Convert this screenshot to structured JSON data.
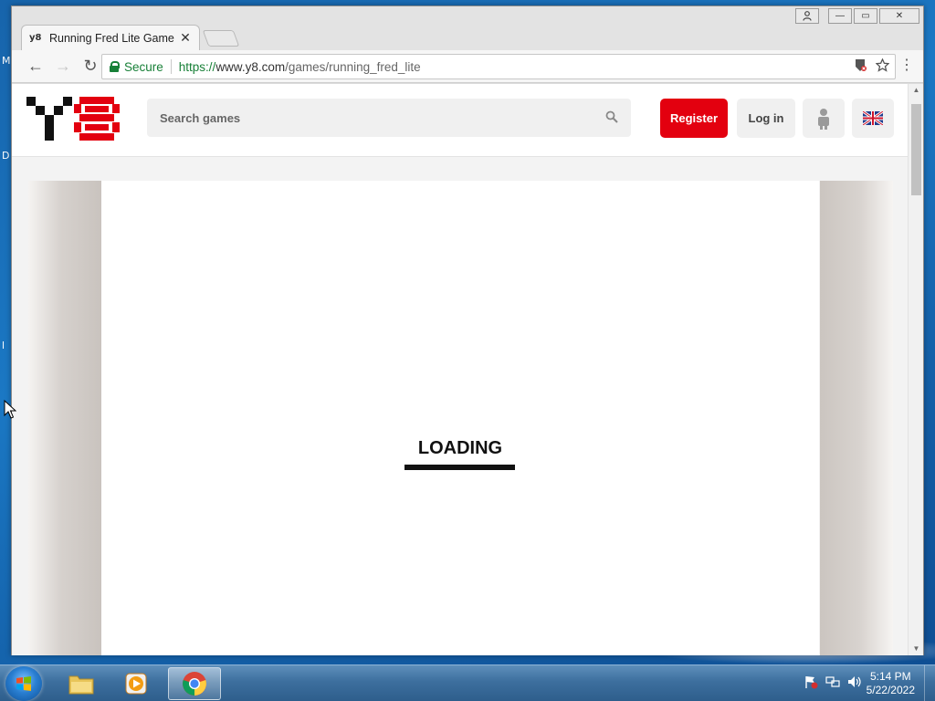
{
  "desktop": {
    "edge_letters": [
      "M",
      "D",
      "l"
    ]
  },
  "browser": {
    "tab": {
      "favicon_text": "y8",
      "title": "Running Fred Lite Game",
      "close_glyph": "✕"
    },
    "window_controls": {
      "minimize": "—",
      "maximize": "▭",
      "close": "✕"
    },
    "toolbar": {
      "back": "←",
      "forward": "→",
      "reload": "↻",
      "secure_label": "Secure",
      "url_scheme": "https://",
      "url_host": "www.y8.com",
      "url_path": "/games/running_fred_lite",
      "menu": "⋮"
    }
  },
  "site": {
    "logo_text": "Y8",
    "search": {
      "placeholder": "Search games"
    },
    "register_label": "Register",
    "login_label": "Log in",
    "brand_color": "#e3000f"
  },
  "game": {
    "loading_label": "LOADING",
    "loading_progress": 0.0
  },
  "taskbar": {
    "items": [
      "Windows Explorer",
      "Windows Media Player",
      "Google Chrome"
    ],
    "active_item": "Google Chrome",
    "clock_time": "5:14 PM",
    "clock_date": "5/22/2022"
  }
}
